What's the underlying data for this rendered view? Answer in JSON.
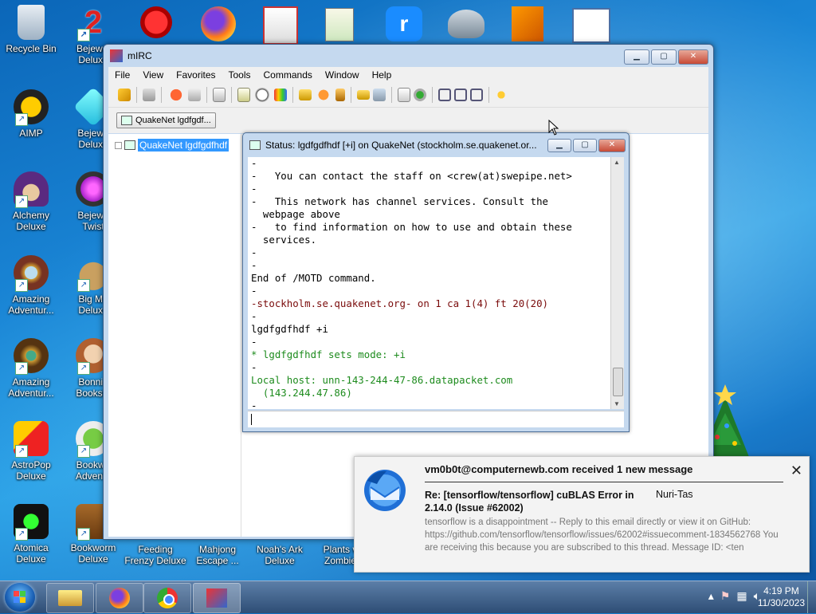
{
  "desktop": {
    "icons": [
      {
        "label": "Recycle Bin"
      },
      {
        "label": "Bejewel\nDeluxe"
      },
      {
        "label": "AIMP"
      },
      {
        "label": "Bejewe\nDeluxe"
      },
      {
        "label": "Alchemy\nDeluxe"
      },
      {
        "label": "Bejewe\nTwist"
      },
      {
        "label": "Amazing\nAdventur..."
      },
      {
        "label": "Big Mo\nDeluxe"
      },
      {
        "label": "Amazing\nAdventur..."
      },
      {
        "label": "Bonnie\nBooksto"
      },
      {
        "label": "AstroPop\nDeluxe"
      },
      {
        "label": "Bookwo\nAdventu"
      },
      {
        "label": "Atomica\nDeluxe"
      },
      {
        "label": "Bookworm\nDeluxe"
      },
      {
        "label": "Feeding\nFrenzy Deluxe"
      },
      {
        "label": "Mahjong\nEscape ..."
      },
      {
        "label": "Noah's Ark\nDeluxe"
      },
      {
        "label": "Plants v\nZombie"
      }
    ]
  },
  "mirc": {
    "title": "mIRC",
    "menu": [
      "File",
      "View",
      "Favorites",
      "Tools",
      "Commands",
      "Window",
      "Help"
    ],
    "switchbar_button": "QuakeNet lgdfgdf...",
    "tree_item": "QuakeNet lgdfgdfhdf"
  },
  "status": {
    "title": "Status: lgdfgdfhdf [+i] on QuakeNet (stockholm.se.quakenet.or...",
    "lines": [
      {
        "text": "-",
        "color": "black"
      },
      {
        "text": "-   You can contact the staff on <crew(at)swepipe.net>",
        "color": "black"
      },
      {
        "text": "-",
        "color": "black"
      },
      {
        "text": "-   This network has channel services. Consult the",
        "color": "black"
      },
      {
        "text": "  webpage above",
        "color": "black"
      },
      {
        "text": "-   to find information on how to use and obtain these",
        "color": "black"
      },
      {
        "text": "  services.",
        "color": "black"
      },
      {
        "text": "-",
        "color": "black"
      },
      {
        "text": "-",
        "color": "black"
      },
      {
        "text": "End of /MOTD command.",
        "color": "black"
      },
      {
        "text": "-",
        "color": "black"
      },
      {
        "text": "-stockholm.se.quakenet.org- on 1 ca 1(4) ft 20(20)",
        "color": "maroon"
      },
      {
        "text": "-",
        "color": "black"
      },
      {
        "text": "lgdfgdfhdf +i",
        "color": "black"
      },
      {
        "text": "-",
        "color": "black"
      },
      {
        "text": "* lgdfgdfhdf sets mode: +i",
        "color": "green"
      },
      {
        "text": "-",
        "color": "black"
      },
      {
        "text": "Local host: unn-143-244-47-86.datapacket.com",
        "color": "green"
      },
      {
        "text": "  (143.244.47.86)",
        "color": "green"
      },
      {
        "text": "-",
        "color": "black"
      }
    ]
  },
  "notification": {
    "header": "vm0b0t@computernewb.com received 1 new message",
    "subject": "Re: [tensorflow/tensorflow] cuBLAS Error in 2.14.0 (Issue #62002)",
    "from": "Nuri-Tas",
    "body": "tensorflow is a disappointment -- Reply to this email directly or view it on GitHub: https://github.com/tensorflow/tensorflow/issues/62002#issuecomment-1834562768 You are receiving this because you are subscribed to this thread. Message ID: <ten"
  },
  "taskbar": {
    "time": "4:19 PM",
    "date": "11/30/2023"
  }
}
